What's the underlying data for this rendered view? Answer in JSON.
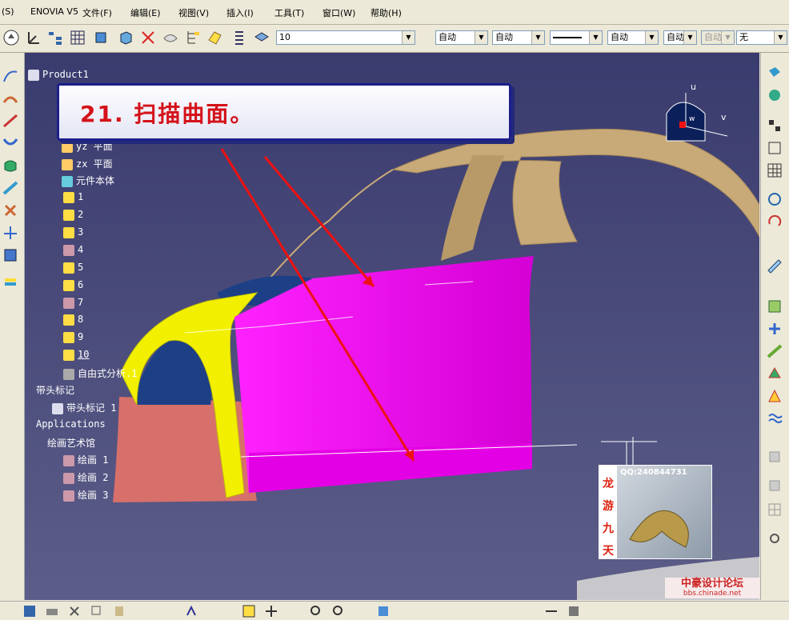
{
  "menu": {
    "items": [
      "(S)",
      "ENOVIA V5",
      "文件(F)",
      "编辑(E)",
      "视图(V)",
      "插入(I)",
      "工具(T)",
      "窗口(W)",
      "帮助(H)"
    ]
  },
  "toolbar": {
    "layer_value": "10",
    "line_color": "自动",
    "line_type": "自动",
    "line_weight": "自动",
    "combo5": "自动",
    "combo6": "自动",
    "combo7": "自动",
    "combo8": "无"
  },
  "tree": {
    "product": "Product1",
    "yz": "yz 平面",
    "zx": "zx 平面",
    "body": "元件本体",
    "items": [
      "1",
      "2",
      "3",
      "4",
      "5",
      "6",
      "7",
      "8",
      "9",
      "10"
    ],
    "freeform": "自由式分析.1",
    "annot": "带头标记",
    "annot1": "带头标记 1",
    "apps": "Applications",
    "gallery": "绘画艺术馆",
    "drawings": [
      "绘画 1",
      "绘画 2",
      "绘画 3"
    ]
  },
  "callout": {
    "text": "21. 扫描曲面。"
  },
  "compass": {
    "u": "u",
    "v": "v",
    "w": "w"
  },
  "watermark": {
    "qq": "QQ:240844731",
    "chars": [
      "龙",
      "游",
      "九",
      "天"
    ],
    "logo": "中豪设计论坛",
    "url": "bbs.chinade.net"
  },
  "colors": {
    "viewport_bg": "#3c3d6e",
    "magenta": "#ee00ee",
    "yellow": "#f2f000",
    "tan": "#c8aa78",
    "red_arrow": "#ee1111"
  }
}
